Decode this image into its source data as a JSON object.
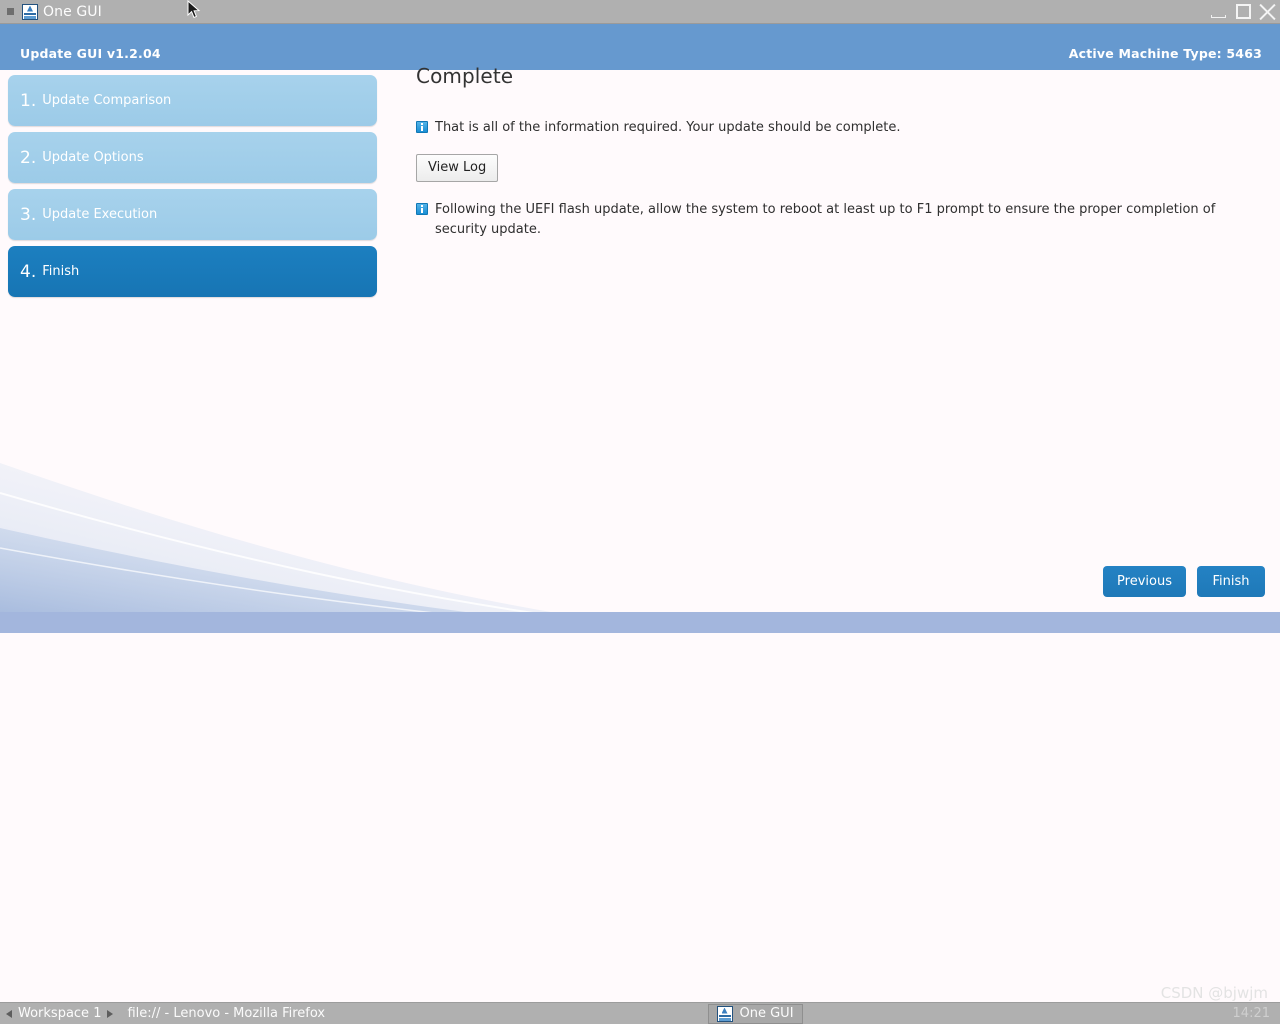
{
  "window": {
    "title": "One GUI",
    "icon": "monitor-icon",
    "controls": {
      "minimize": "minimize-icon",
      "maximize": "maximize-icon",
      "close": "close-icon"
    }
  },
  "app": {
    "header": {
      "left_title": "Update GUI v1.2.04",
      "right_info": "Active Machine Type: 5463"
    },
    "sidebar": {
      "items": [
        {
          "num": "1.",
          "label": "Update Comparison",
          "active": false
        },
        {
          "num": "2.",
          "label": "Update Options",
          "active": false
        },
        {
          "num": "3.",
          "label": "Update Execution",
          "active": false
        },
        {
          "num": "4.",
          "label": "Finish",
          "active": true
        }
      ]
    },
    "content": {
      "title": "Complete",
      "info_1": "That is all of the information required. Your update should be complete.",
      "view_log_label": "View Log",
      "info_2": "Following the UEFI flash update, allow the system to reboot at least up to F1 prompt to ensure the proper completion of security update."
    },
    "footer": {
      "previous_label": "Previous",
      "finish_label": "Finish"
    }
  },
  "taskbar": {
    "workspace_label": "Workspace 1",
    "prev_arrow": "arrow-left-icon",
    "next_arrow": "arrow-right-icon",
    "tasks": [
      {
        "label": "file:// - Lenovo - Mozilla Firefox",
        "icon": null,
        "active": false
      },
      {
        "label": "One GUI",
        "icon": "monitor-icon",
        "active": true
      }
    ],
    "clock": "14:21"
  },
  "watermark": "CSDN @bjwjm",
  "colors": {
    "header_blue": "#6699cf",
    "nav_inactive": "#a7d2ec",
    "nav_active": "#1c7fc0",
    "button_blue": "#2482c4",
    "footer_bar": "#a3b6dd",
    "taskbar_gray": "#b0b0b0"
  }
}
